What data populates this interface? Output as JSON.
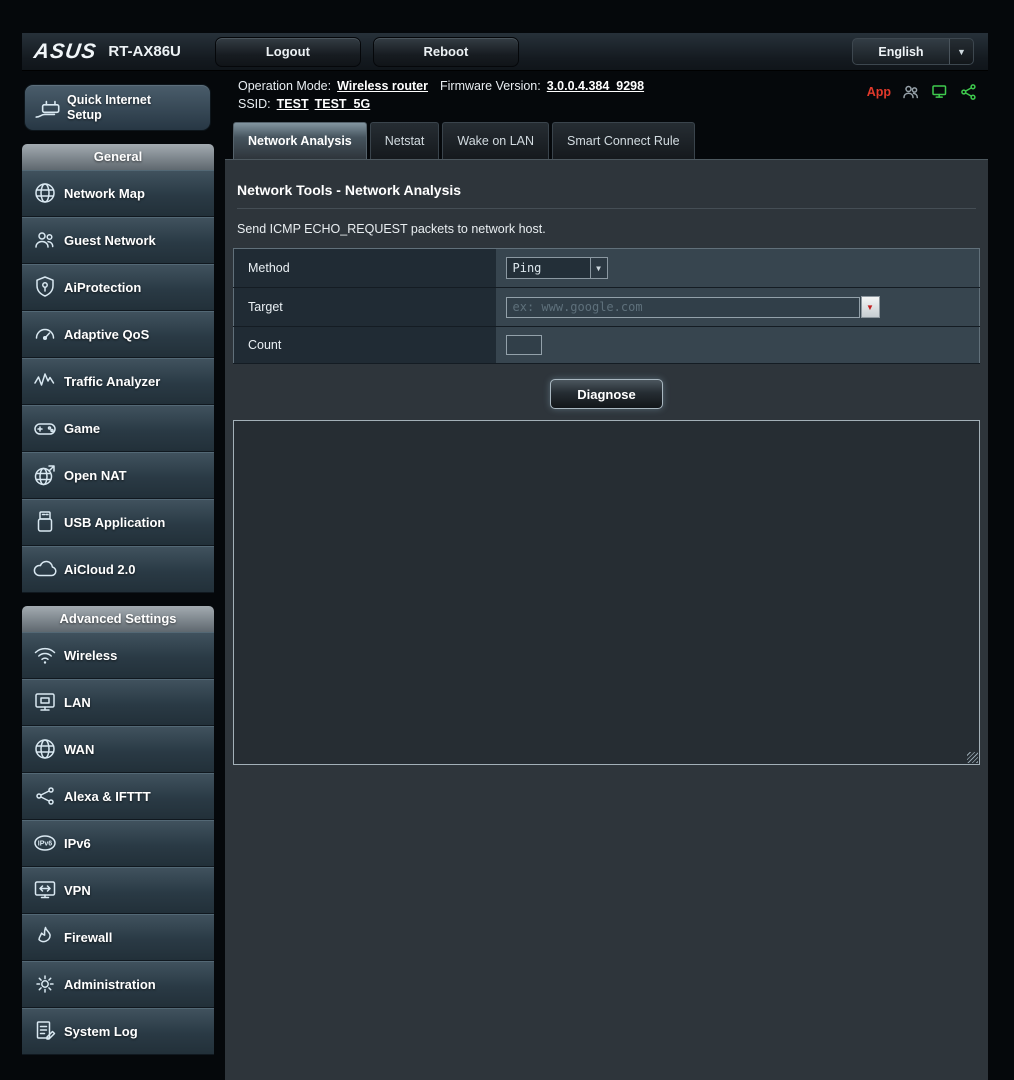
{
  "header": {
    "brand": "ASUS",
    "model": "RT-AX86U",
    "logout": "Logout",
    "reboot": "Reboot",
    "language": "English"
  },
  "infobar": {
    "operation_mode_label": "Operation Mode:",
    "operation_mode_value": "Wireless router",
    "firmware_label": "Firmware Version:",
    "firmware_value": "3.0.0.4.384_9298",
    "ssid_label": "SSID:",
    "ssid_1": "TEST",
    "ssid_2": "TEST_5G",
    "app_label": "App"
  },
  "sidebar": {
    "quick_setup_line1": "Quick Internet",
    "quick_setup_line2": "Setup",
    "sections": [
      {
        "title": "General",
        "items": [
          "Network Map",
          "Guest Network",
          "AiProtection",
          "Adaptive QoS",
          "Traffic Analyzer",
          "Game",
          "Open NAT",
          "USB Application",
          "AiCloud 2.0"
        ]
      },
      {
        "title": "Advanced Settings",
        "items": [
          "Wireless",
          "LAN",
          "WAN",
          "Alexa & IFTTT",
          "IPv6",
          "VPN",
          "Firewall",
          "Administration",
          "System Log"
        ]
      }
    ]
  },
  "tabs": {
    "items": [
      "Network Analysis",
      "Netstat",
      "Wake on LAN",
      "Smart Connect Rule"
    ],
    "active": "Network Analysis"
  },
  "main": {
    "title": "Network Tools - Network Analysis",
    "description": "Send ICMP ECHO_REQUEST packets to network host.",
    "form": {
      "method_label": "Method",
      "method_value": "Ping",
      "target_label": "Target",
      "target_placeholder": "ex: www.google.com",
      "count_label": "Count",
      "count_value": ""
    },
    "diagnose_label": "Diagnose",
    "result_value": ""
  },
  "colors": {
    "app_label_red": "#e2392b",
    "status_icon_green": "#3fca4e",
    "panel_bg": "#2e353b",
    "sidebar_item_top": "#41535f"
  }
}
